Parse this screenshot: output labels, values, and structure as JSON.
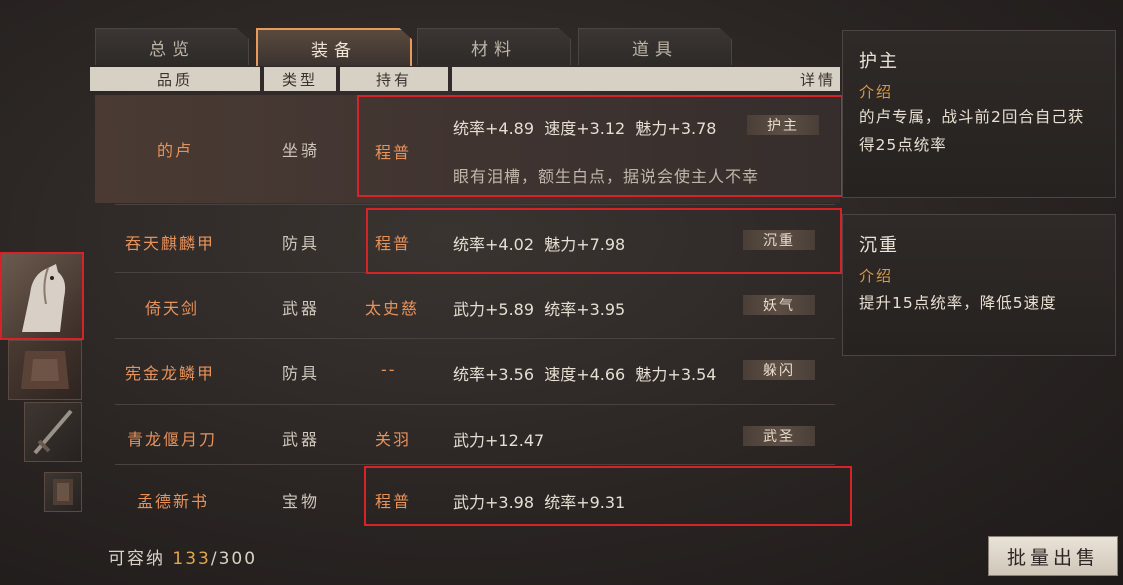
{
  "tabs": [
    {
      "label": "总览",
      "active": false
    },
    {
      "label": "装备",
      "active": true
    },
    {
      "label": "材料",
      "active": false
    },
    {
      "label": "道具",
      "active": false
    }
  ],
  "columns": {
    "quality": "品质",
    "type": "类型",
    "owner": "持有",
    "detail": "详情"
  },
  "rows": [
    {
      "name": "的卢",
      "type": "坐骑",
      "owner": "程普",
      "stats": "统率+4.89  速度+3.12  魅力+3.78",
      "tag": "护主",
      "desc": "眼有泪槽，额生白点，据说会使主人不幸"
    },
    {
      "name": "吞天麒麟甲",
      "type": "防具",
      "owner": "程普",
      "stats": "统率+4.02  魅力+7.98",
      "tag": "沉重",
      "desc": ""
    },
    {
      "name": "倚天剑",
      "type": "武器",
      "owner": "太史慈",
      "stats": "武力+5.89  统率+3.95",
      "tag": "妖气",
      "desc": ""
    },
    {
      "name": "宪金龙鳞甲",
      "type": "防具",
      "owner": "--",
      "stats": "统率+3.56  速度+4.66  魅力+3.54",
      "tag": "躲闪",
      "desc": ""
    },
    {
      "name": "青龙偃月刀",
      "type": "武器",
      "owner": "关羽",
      "stats": "武力+12.47",
      "tag": "武圣",
      "desc": ""
    },
    {
      "name": "孟德新书",
      "type": "宝物",
      "owner": "程普",
      "stats": "武力+3.98  统率+9.31",
      "tag": "",
      "desc": ""
    }
  ],
  "panels": [
    {
      "title": "护主",
      "subtitle": "介绍",
      "text": "的卢专属，战斗前2回合自己获得25点统率"
    },
    {
      "title": "沉重",
      "subtitle": "介绍",
      "text": "提升15点统率，降低5速度"
    }
  ],
  "capacity": {
    "label": "可容纳 ",
    "used": "133",
    "total": "/300"
  },
  "batch_sell_label": "批量出售",
  "colors": {
    "accent": "#e8925a",
    "highlight": "#d6232a",
    "capacity_used": "#e0a84a"
  }
}
